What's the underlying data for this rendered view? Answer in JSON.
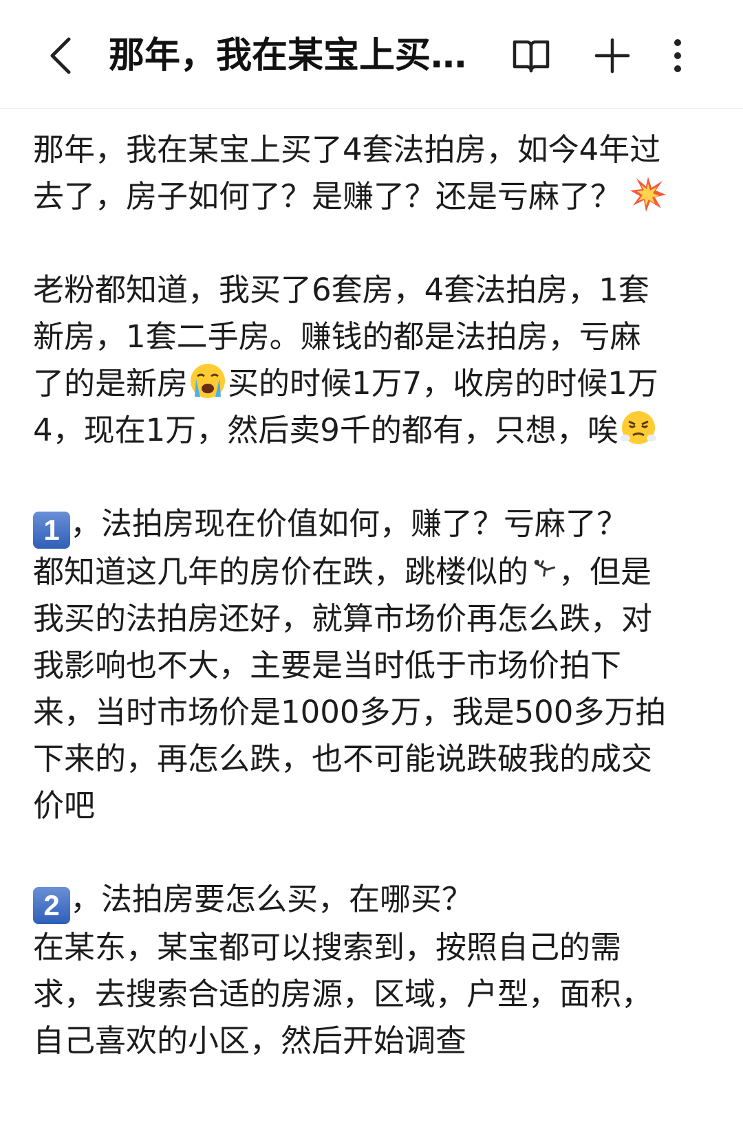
{
  "header": {
    "title": "那年，我在某宝上买…",
    "back_icon": "chevron-left-icon",
    "book_icon": "book-icon",
    "plus_icon": "plus-icon",
    "more_icon": "more-vertical-icon"
  },
  "article": {
    "intro": {
      "line1": "那年，我在某宝上买了4套法拍房，如今4年过",
      "line2": "去了，房子如何了？是赚了？还是亏麻了？",
      "emoji": "collision-emoji"
    },
    "p2": {
      "line1": "老粉都知道，我买了6套房，4套法拍房，1套",
      "line2": "新房，1套二手房。赚钱的都是法拍房，亏麻",
      "line3a": "了的是新房",
      "emoji1": "crying-face-emoji",
      "line3b": "买的时候1万7，收房的时候1万",
      "line4": "4，现在1万，然后卖9千的都有，只想，唉",
      "emoji2": "steam-face-emoji"
    },
    "s1": {
      "badge": "1",
      "heading": "，法拍房现在价值如何，赚了？亏麻了？",
      "line1a": "都知道这几年的房价在跌，跳楼似的",
      "emoji": "diving-person-emoji",
      "line1b": "，但是",
      "line2": "我买的法拍房还好，就算市场价再怎么跌，对",
      "line3": "我影响也不大，主要是当时低于市场价拍下",
      "line4": "来，当时市场价是1000多万，我是500多万拍",
      "line5": "下来的，再怎么跌，也不可能说跌破我的成交",
      "line6": "价吧"
    },
    "s2": {
      "badge": "2",
      "heading": "，法拍房要怎么买，在哪买？",
      "line1": "在某东，某宝都可以搜索到，按照自己的需",
      "line2": "求，去搜索合适的房源，区域，户型，面积，",
      "line3": "自己喜欢的小区，然后开始调查"
    }
  }
}
